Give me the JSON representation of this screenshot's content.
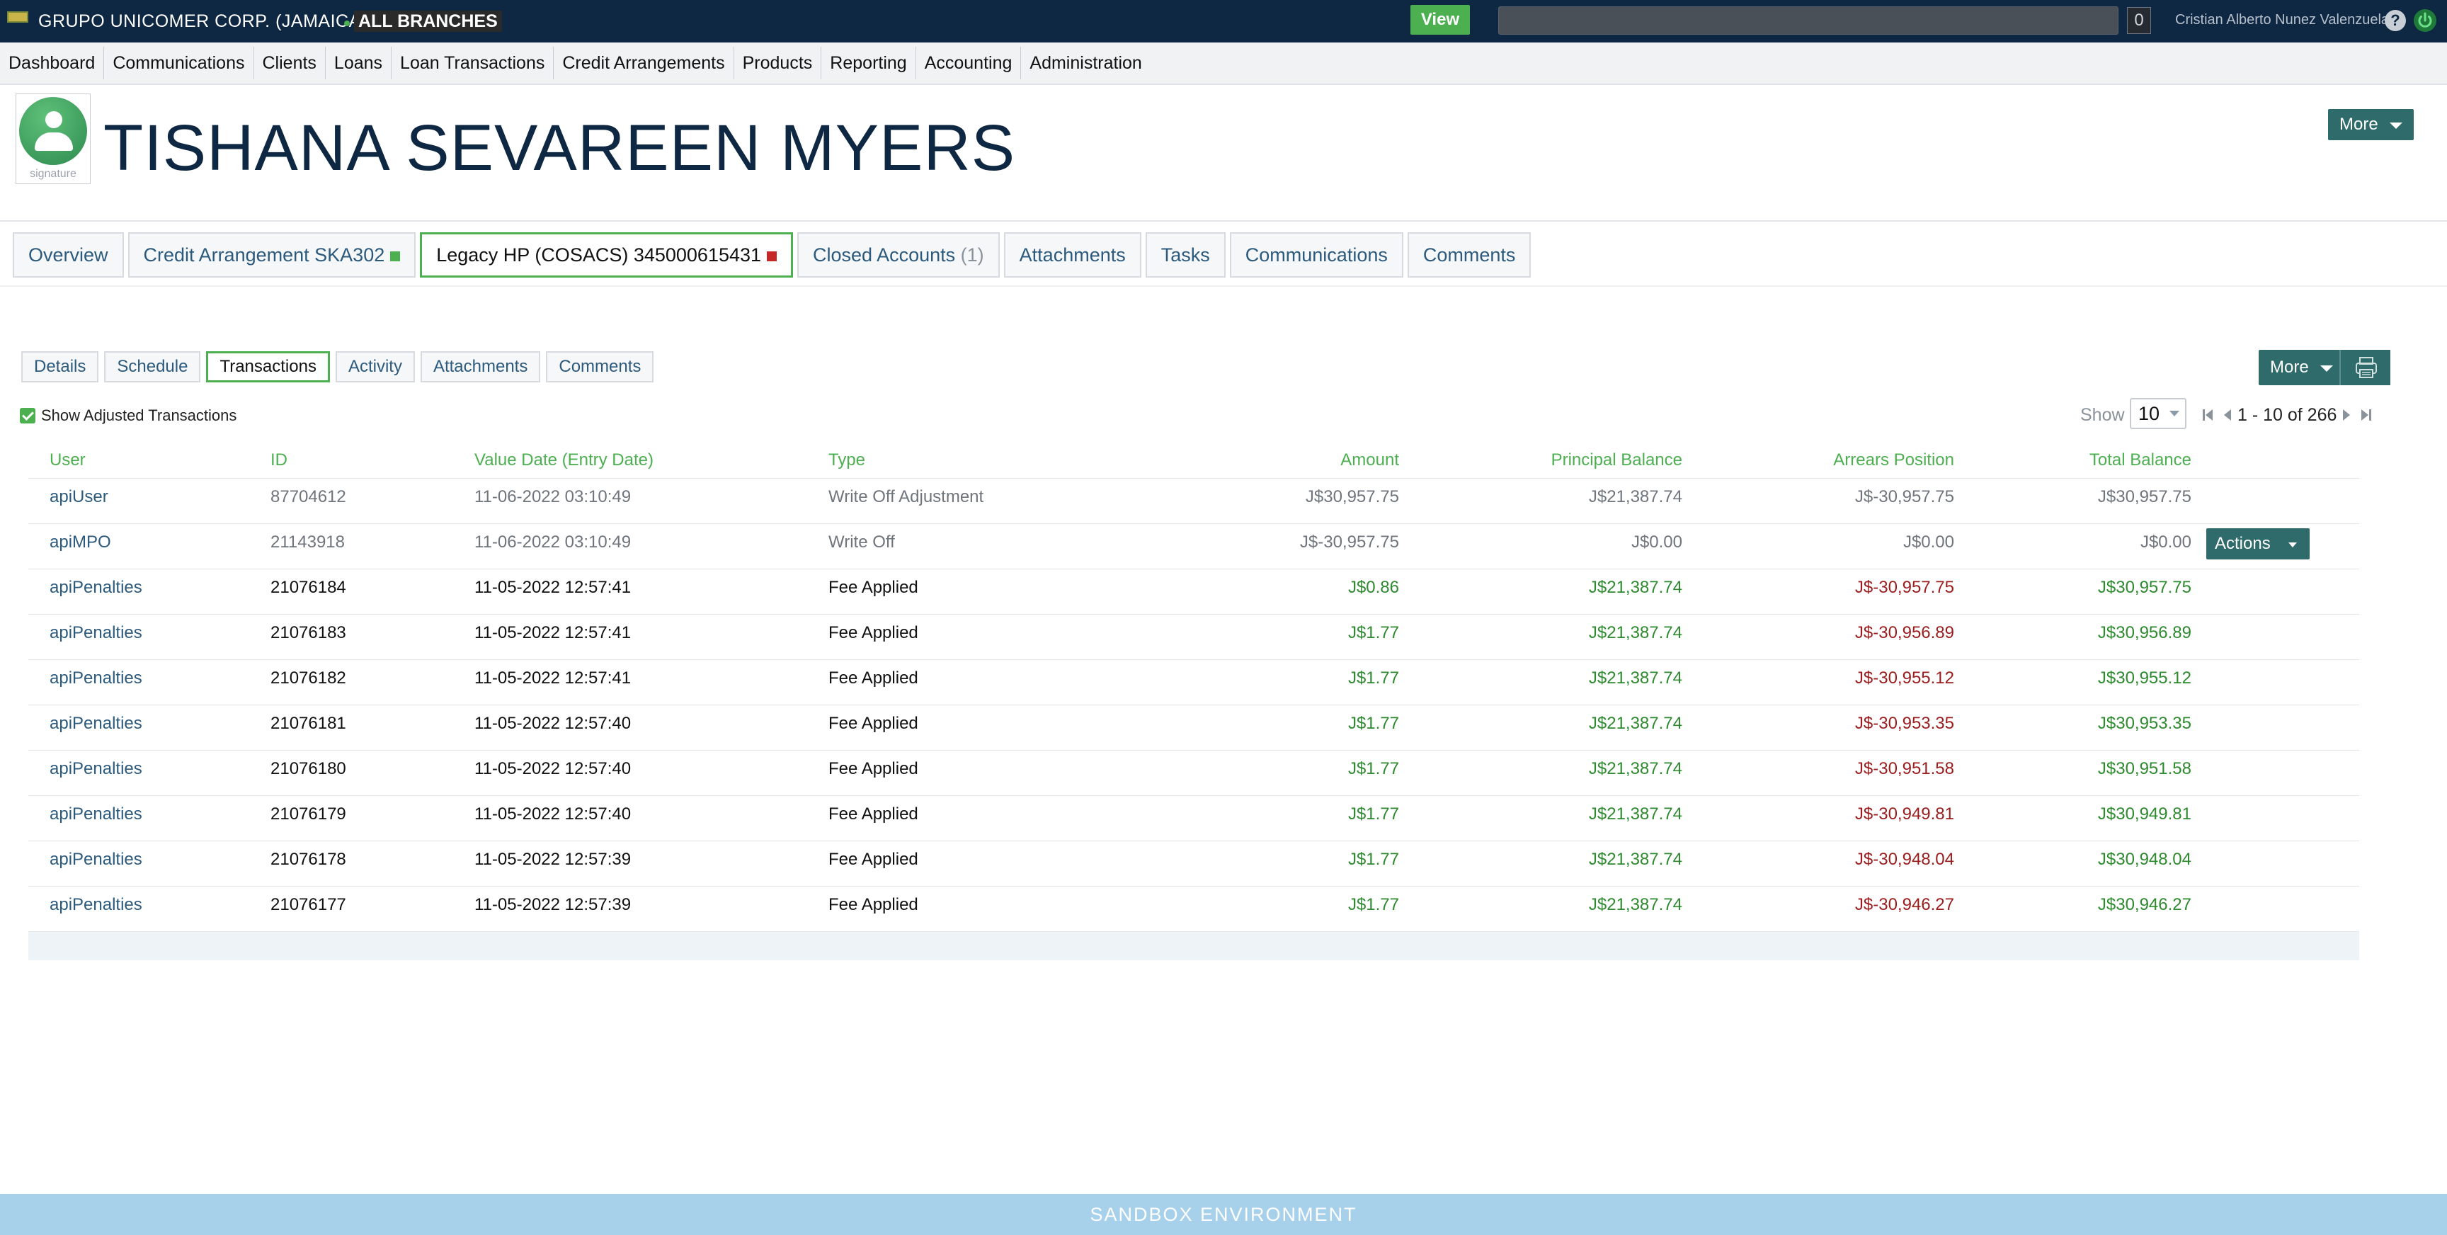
{
  "topbar": {
    "org_name": "GRUPO UNICOMER CORP. (JAMAICA)",
    "branch": "ALL BRANCHES",
    "view_label": "View",
    "notification_count": "0",
    "user_name": "Cristian Alberto Nunez Valenzuela",
    "help_glyph": "?"
  },
  "nav": {
    "items": [
      "Dashboard",
      "Communications",
      "Clients",
      "Loans",
      "Loan Transactions",
      "Credit Arrangements",
      "Products",
      "Reporting",
      "Accounting",
      "Administration"
    ]
  },
  "client": {
    "name": "TISHANA SEVAREEN MYERS",
    "avatar_caption": "signature",
    "more_label": "More"
  },
  "account_tabs": {
    "overview": "Overview",
    "credit_arrangement": "Credit Arrangement SKA302",
    "legacy": "Legacy HP (COSACS) 345000615431",
    "closed_accounts": "Closed Accounts",
    "closed_count": "(1)",
    "attachments": "Attachments",
    "tasks": "Tasks",
    "communications": "Communications",
    "comments": "Comments"
  },
  "sub_tabs": {
    "details": "Details",
    "schedule": "Schedule",
    "transactions": "Transactions",
    "activity": "Activity",
    "attachments": "Attachments",
    "comments": "Comments",
    "more_label": "More"
  },
  "filters": {
    "show_adjusted_label": "Show Adjusted Transactions",
    "show_label": "Show",
    "page_size": "10",
    "range_text": "1 - 10 of 266"
  },
  "table": {
    "headers": {
      "user": "User",
      "id": "ID",
      "value_date": "Value Date (Entry Date)",
      "type": "Type",
      "amount": "Amount",
      "principal_balance": "Principal Balance",
      "arrears_position": "Arrears Position",
      "total_balance": "Total Balance"
    },
    "actions_label": "Actions",
    "rows": [
      {
        "user": "apiUser",
        "id": "87704612",
        "date": "11-06-2022 03:10:49",
        "type": "Write Off Adjustment",
        "amount": "J$30,957.75",
        "principal": "J$21,387.74",
        "arrears": "J$-30,957.75",
        "total": "J$30,957.75"
      },
      {
        "user": "apiMPO",
        "id": "21143918",
        "date": "11-06-2022 03:10:49",
        "type": "Write Off",
        "amount": "J$-30,957.75",
        "principal": "J$0.00",
        "arrears": "J$0.00",
        "total": "J$0.00"
      },
      {
        "user": "apiPenalties",
        "id": "21076184",
        "date": "11-05-2022 12:57:41",
        "type": "Fee Applied",
        "amount": "J$0.86",
        "principal": "J$21,387.74",
        "arrears": "J$-30,957.75",
        "total": "J$30,957.75"
      },
      {
        "user": "apiPenalties",
        "id": "21076183",
        "date": "11-05-2022 12:57:41",
        "type": "Fee Applied",
        "amount": "J$1.77",
        "principal": "J$21,387.74",
        "arrears": "J$-30,956.89",
        "total": "J$30,956.89"
      },
      {
        "user": "apiPenalties",
        "id": "21076182",
        "date": "11-05-2022 12:57:41",
        "type": "Fee Applied",
        "amount": "J$1.77",
        "principal": "J$21,387.74",
        "arrears": "J$-30,955.12",
        "total": "J$30,955.12"
      },
      {
        "user": "apiPenalties",
        "id": "21076181",
        "date": "11-05-2022 12:57:40",
        "type": "Fee Applied",
        "amount": "J$1.77",
        "principal": "J$21,387.74",
        "arrears": "J$-30,953.35",
        "total": "J$30,953.35"
      },
      {
        "user": "apiPenalties",
        "id": "21076180",
        "date": "11-05-2022 12:57:40",
        "type": "Fee Applied",
        "amount": "J$1.77",
        "principal": "J$21,387.74",
        "arrears": "J$-30,951.58",
        "total": "J$30,951.58"
      },
      {
        "user": "apiPenalties",
        "id": "21076179",
        "date": "11-05-2022 12:57:40",
        "type": "Fee Applied",
        "amount": "J$1.77",
        "principal": "J$21,387.74",
        "arrears": "J$-30,949.81",
        "total": "J$30,949.81"
      },
      {
        "user": "apiPenalties",
        "id": "21076178",
        "date": "11-05-2022 12:57:39",
        "type": "Fee Applied",
        "amount": "J$1.77",
        "principal": "J$21,387.74",
        "arrears": "J$-30,948.04",
        "total": "J$30,948.04"
      },
      {
        "user": "apiPenalties",
        "id": "21076177",
        "date": "11-05-2022 12:57:39",
        "type": "Fee Applied",
        "amount": "J$1.77",
        "principal": "J$21,387.74",
        "arrears": "J$-30,946.27",
        "total": "J$30,946.27"
      }
    ]
  },
  "footer": {
    "environment": "SANDBOX ENVIRONMENT"
  },
  "colors": {
    "topbar": "#0e2742",
    "accent_green": "#4caf50",
    "button_teal": "#2e6b6a",
    "negative_red": "#9b1c1c",
    "sandbox_banner": "#a7d0ea"
  },
  "icons": {
    "flag": "flag-icon",
    "help": "help-icon",
    "power": "power-icon",
    "avatar": "user-avatar-icon",
    "print": "printer-icon",
    "pager": [
      "first-page-icon",
      "prev-page-icon",
      "next-page-icon",
      "last-page-icon"
    ]
  }
}
